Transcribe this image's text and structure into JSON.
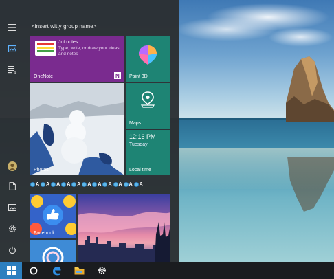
{
  "start_menu": {
    "group_name": "<insert witty group name>",
    "tiles": {
      "onenote": {
        "headline": "Jot notes",
        "description": "Type, write, or draw your ideas and notes",
        "label": "OneNote"
      },
      "paint3d": {
        "label": "Paint 3D"
      },
      "photos": {
        "label": "Photos"
      },
      "maps": {
        "label": "Maps"
      },
      "clock": {
        "time": "12:16 PM",
        "day": "Tuesday",
        "label": "Local time"
      },
      "facebook": {
        "label": "Facebook"
      }
    },
    "emoji_row": [
      "A",
      "A",
      "A",
      "A",
      "A",
      "A",
      "A",
      "A",
      "A",
      "A",
      "A"
    ],
    "rail_icons": [
      "hamburger-menu-icon",
      "tiles-icon",
      "recent-list-icon",
      "user-avatar",
      "document-icon",
      "pictures-icon",
      "settings-icon",
      "power-icon"
    ]
  },
  "colors": {
    "menu_background": "#2b2f33",
    "tile_teal": "#1e8474",
    "tile_purple": "#7a2b8f",
    "accent_blue": "#2d7fbf",
    "taskbar": "#1a1c1f"
  },
  "taskbar": {
    "icons": [
      "windows-start-icon",
      "cortana-circle-icon",
      "edge-browser-icon",
      "file-explorer-icon",
      "settings-gear-icon"
    ]
  }
}
